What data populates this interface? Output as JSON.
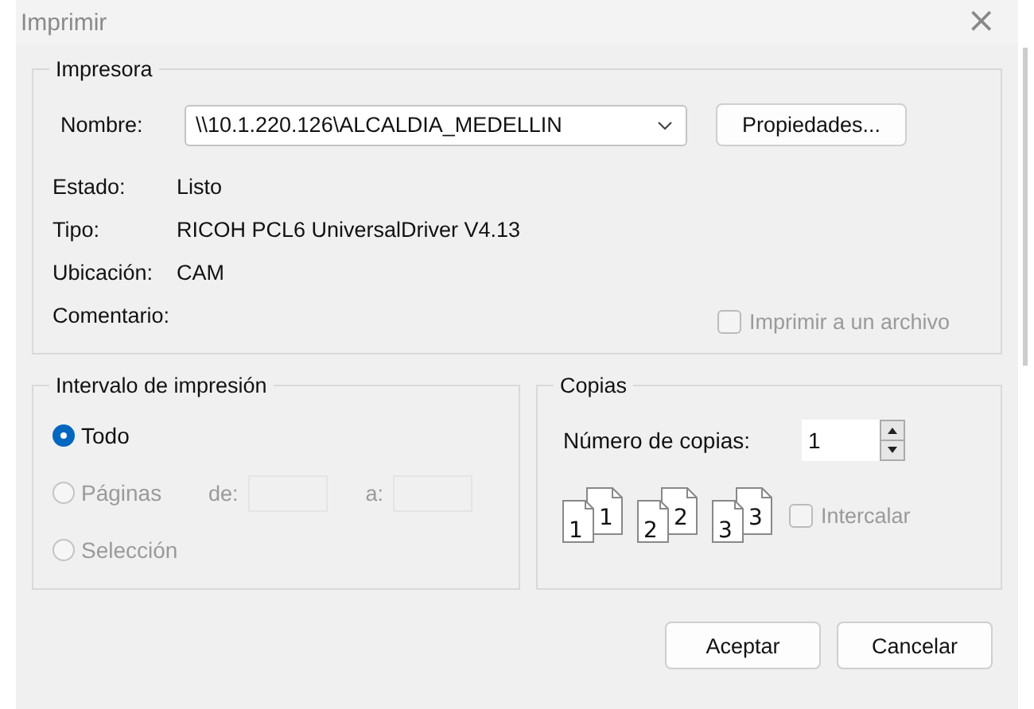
{
  "window": {
    "title": "Imprimir",
    "close": "×"
  },
  "printer": {
    "legend": "Impresora",
    "name_label": "Nombre:",
    "name_value": "\\\\10.1.220.126\\ALCALDIA_MEDELLIN",
    "properties_button": "Propiedades...",
    "info": [
      {
        "label": "Estado:",
        "value": "Listo"
      },
      {
        "label": "Tipo:",
        "value": "RICOH PCL6 UniversalDriver V4.13"
      },
      {
        "label": "Ubicación:",
        "value": "CAM"
      },
      {
        "label": "Comentario:"
      }
    ],
    "print_to_file": {
      "label": "Imprimir a un archivo",
      "checked": false,
      "disabled": true
    }
  },
  "range": {
    "legend": "Intervalo de impresión",
    "options": [
      {
        "label": "Todo",
        "selected": true,
        "disabled": false,
        "kind": "plain"
      },
      {
        "label": "Páginas",
        "selected": false,
        "disabled": true,
        "kind": "pages"
      },
      {
        "label": "Selección",
        "selected": false,
        "disabled": true,
        "kind": "plain"
      }
    ],
    "from_label": "de:",
    "to_label": "a:"
  },
  "copies": {
    "legend": "Copias",
    "count_label": "Número de copias:",
    "count_value": "1",
    "stacks": [
      {
        "back": "1",
        "front": "1"
      },
      {
        "back": "2",
        "front": "2"
      },
      {
        "back": "3",
        "front": "3"
      }
    ],
    "collate": {
      "label": "Intercalar",
      "checked": false,
      "disabled": true
    }
  },
  "buttons": [
    "Aceptar",
    "Cancelar"
  ]
}
